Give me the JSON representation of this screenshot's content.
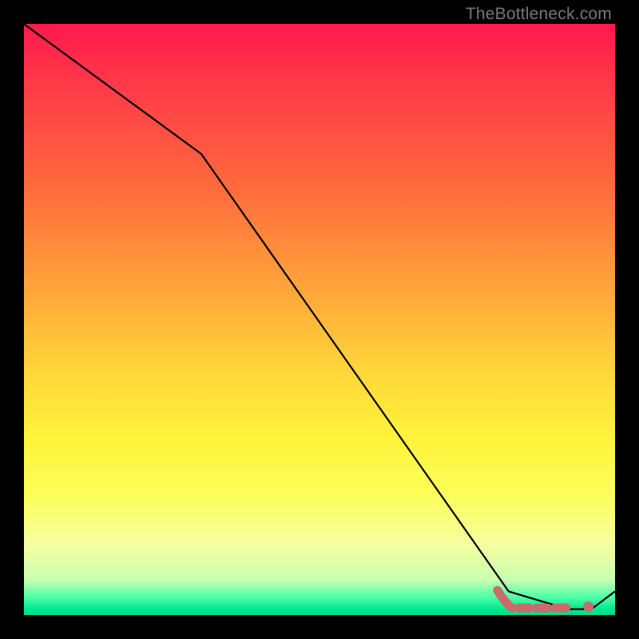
{
  "credit_text": "TheBottleneck.com",
  "colors": {
    "frame": "#000000",
    "line": "#000000",
    "marker": "#c96b6b",
    "credit_text": "#777777"
  },
  "chart_data": {
    "type": "line",
    "title": "",
    "xlabel": "",
    "ylabel": "",
    "xlim": [
      0,
      100
    ],
    "ylim": [
      0,
      100
    ],
    "grid": false,
    "series": [
      {
        "name": "curve",
        "x": [
          0,
          30,
          82,
          92,
          96,
          100
        ],
        "y": [
          100,
          78,
          4,
          1,
          1,
          4
        ],
        "note": "y as percent of plot height from bottom; read visually, no numeric axes shown"
      }
    ],
    "markers": {
      "style": "dashed-segment-with-dot",
      "dash_x_range": [
        82,
        92
      ],
      "dash_y": 1.2,
      "dot": {
        "x": 95.5,
        "y": 1.4
      }
    },
    "axes_visible": false
  }
}
